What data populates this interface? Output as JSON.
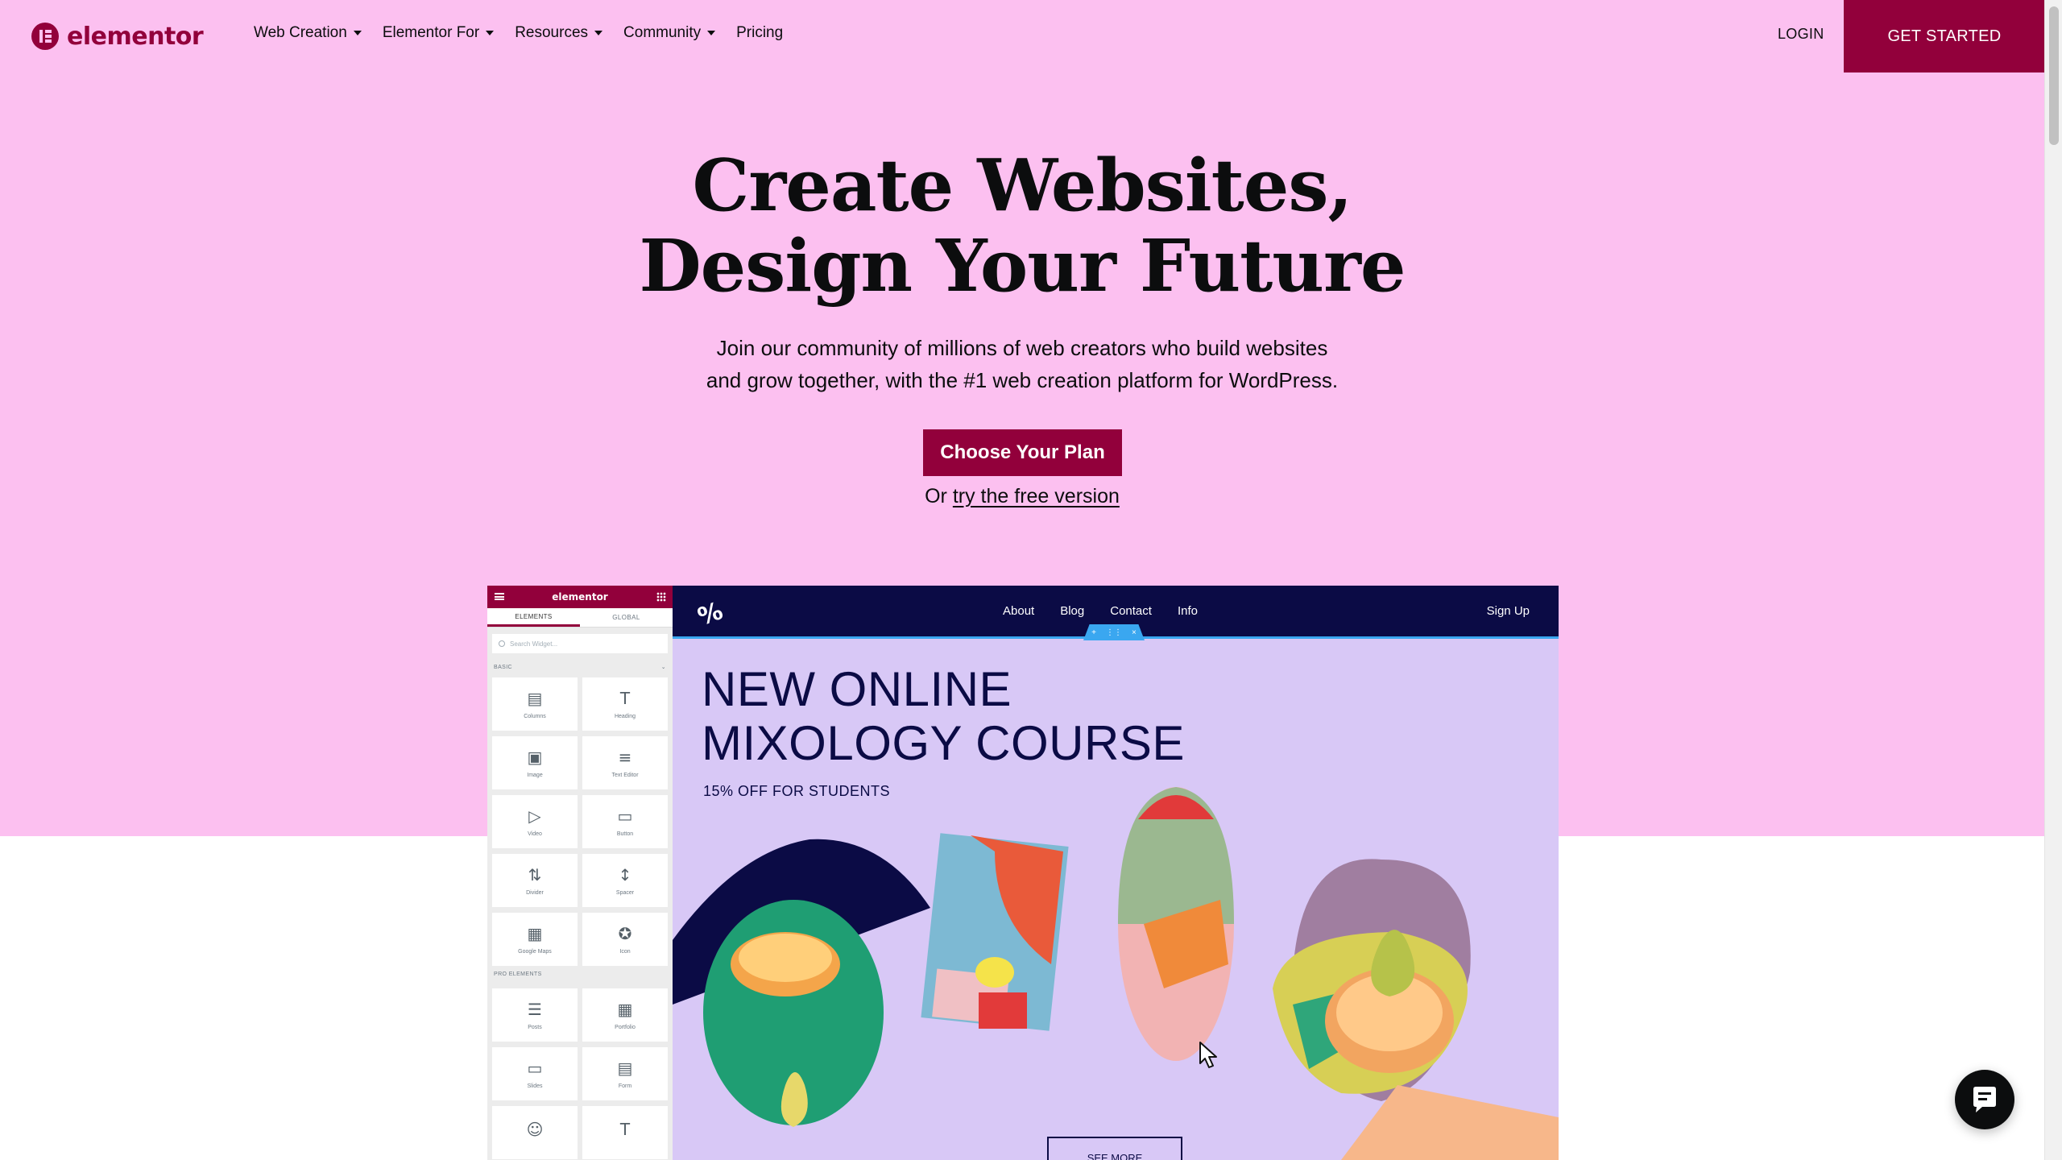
{
  "brand": {
    "name": "elementor",
    "color": "#92003b",
    "hero_bg": "#fcc0f0"
  },
  "nav": {
    "items": [
      {
        "label": "Web Creation",
        "dropdown": true
      },
      {
        "label": "Elementor For",
        "dropdown": true
      },
      {
        "label": "Resources",
        "dropdown": true
      },
      {
        "label": "Community",
        "dropdown": true
      },
      {
        "label": "Pricing",
        "dropdown": false
      }
    ],
    "login": "LOGIN",
    "get_started": "GET STARTED"
  },
  "hero": {
    "title_line1": "Create Websites,",
    "title_line2": "Design Your Future",
    "sub_line1": "Join our community of millions of web creators who build websites",
    "sub_line2": "and grow together, with the #1 web creation platform for WordPress.",
    "cta": "Choose Your Plan",
    "or_text": "Or",
    "free_link": "try the free version"
  },
  "editor": {
    "panel": {
      "logo": "elementor",
      "tab_elements": "ELEMENTS",
      "tab_global": "GLOBAL",
      "search_placeholder": "Search Widget...",
      "basic_label": "BASIC",
      "pro_label": "PRO ELEMENTS",
      "basic_widgets": [
        {
          "label": "Columns",
          "icon": "columns-icon"
        },
        {
          "label": "Heading",
          "icon": "heading-icon"
        },
        {
          "label": "Image",
          "icon": "image-icon"
        },
        {
          "label": "Text Editor",
          "icon": "text-editor-icon"
        },
        {
          "label": "Video",
          "icon": "video-icon"
        },
        {
          "label": "Button",
          "icon": "button-icon"
        },
        {
          "label": "Divider",
          "icon": "divider-icon"
        },
        {
          "label": "Spacer",
          "icon": "spacer-icon"
        },
        {
          "label": "Google Maps",
          "icon": "map-icon"
        },
        {
          "label": "Icon",
          "icon": "star-icon"
        }
      ],
      "pro_widgets": [
        {
          "label": "Posts",
          "icon": "posts-icon"
        },
        {
          "label": "Portfolio",
          "icon": "portfolio-icon"
        },
        {
          "label": "Slides",
          "icon": "slides-icon"
        },
        {
          "label": "Form",
          "icon": "form-icon"
        },
        {
          "label": "",
          "icon": "login-icon"
        },
        {
          "label": "",
          "icon": "title-icon"
        }
      ]
    },
    "site": {
      "links": [
        "About",
        "Blog",
        "Contact",
        "Info"
      ],
      "signup": "Sign Up",
      "headline_line1": "NEW ONLINE",
      "headline_line2": "MIXOLOGY COURSE",
      "discount": "15% OFF FOR STUDENTS",
      "see_more": "SEE MORE"
    }
  }
}
